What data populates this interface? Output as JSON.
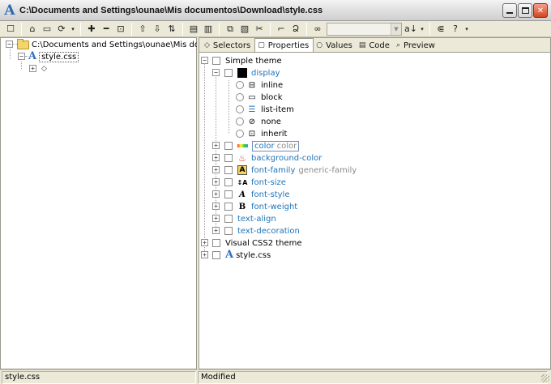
{
  "window": {
    "title": "C:\\Documents and Settings\\ounae\\Mis documentos\\Download\\style.css",
    "app_icon_glyph": "A",
    "controls": {
      "minimize": "",
      "maximize": "",
      "close": "✕"
    }
  },
  "toolbar": {
    "icons": [
      "new",
      "open",
      "save",
      "refresh",
      "dropdown",
      "add",
      "remove",
      "expand-box",
      "move-up",
      "move-down",
      "sort-az",
      "copy-format",
      "paste-format",
      "copy",
      "paste",
      "cut",
      "comment",
      "find-glyph",
      "binoculars",
      "font-size",
      "dropdown",
      "color-pick",
      "help",
      "dropdown"
    ],
    "glyphs": {
      "new": "☐",
      "open": "⌂",
      "save": "▭",
      "refresh": "⟳",
      "dropdown": "▾",
      "add": "✚",
      "remove": "━",
      "expand-box": "⊡",
      "move-up": "⇧",
      "move-down": "⇩",
      "sort-az": "⇅",
      "copy-format": "▤",
      "paste-format": "▥",
      "copy": "⧉",
      "paste": "▧",
      "cut": "✂",
      "comment": "⌐",
      "find-glyph": "Ձ",
      "binoculars": "∞",
      "font-size": "a↓",
      "color-pick": "⋐",
      "help": "?"
    },
    "combo_value": ""
  },
  "left_tree": {
    "root_label": "C:\\Documents and Settings\\ounae\\Mis docu",
    "file_label": "style.css",
    "child_glyph": "◇"
  },
  "tabs": [
    {
      "label": "Selectors",
      "glyph": "◇"
    },
    {
      "label": "Properties",
      "glyph": "▢"
    },
    {
      "label": "Values",
      "glyph": "○"
    },
    {
      "label": "Code",
      "glyph": "▤"
    },
    {
      "label": "Preview",
      "glyph": "⌕"
    }
  ],
  "properties_tree": {
    "simple_theme": "Simple theme",
    "display": "display",
    "display_values": [
      "inline",
      "block",
      "list-item",
      "none",
      "inherit"
    ],
    "display_glyphs": [
      "⊟",
      "▭",
      "☰",
      "⊘",
      "⊡"
    ],
    "color": "color",
    "color_hint": "color",
    "background_color": "background-color",
    "font_family": "font-family",
    "font_family_hint": "generic-family",
    "font_size": "font-size",
    "font_style": "font-style",
    "font_weight": "font-weight",
    "text_align": "text-align",
    "text_decoration": "text-decoration",
    "visual_theme": "Visual CSS2 theme",
    "style_file": "style.css",
    "glyphs": {
      "font_family": "A",
      "font_size": "↕A",
      "font_style": "A",
      "font_weight": "B",
      "style_file": "A"
    }
  },
  "statusbar": {
    "left": "style.css",
    "right": "Modified"
  },
  "colors": {
    "accent_blue": "#2074b8",
    "title_bg": "#e0e0e0",
    "chrome": "#ece9d8",
    "close_button": "#d3431f"
  }
}
